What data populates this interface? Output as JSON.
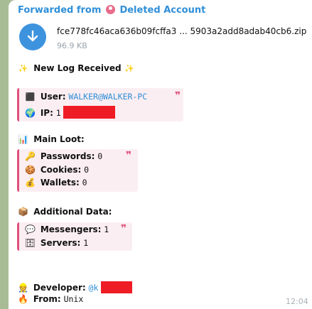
{
  "header": {
    "forwarded_prefix": "Forwarded from",
    "forwarded_from": "Deleted Account"
  },
  "file": {
    "name": "fce778fc46aca636b09fcffa3 ... 5903a2add8adab40cb6.zip",
    "size": "96.9 KB"
  },
  "log_title": "New Log Received",
  "user": {
    "label": "User:",
    "value": "WALKER@WALKER-PC",
    "ip_label": "IP:",
    "ip_value": "1"
  },
  "main_loot": {
    "heading": "Main Loot:",
    "passwords_label": "Passwords:",
    "passwords_value": "0",
    "cookies_label": "Cookies:",
    "cookies_value": "0",
    "wallets_label": "Wallets:",
    "wallets_value": "0"
  },
  "additional": {
    "heading": "Additional Data:",
    "messengers_label": "Messengers:",
    "messengers_value": "1",
    "servers_label": "Servers:",
    "servers_value": "1"
  },
  "developer": {
    "label": "Developer:",
    "value": "@k"
  },
  "from": {
    "label": "From:",
    "value": "Unix"
  },
  "timestamp": "12:04",
  "quote_mark": "❞",
  "icons": {
    "sparkle": "✨",
    "user": "⬛",
    "globe": "🌍",
    "chart": "📊",
    "key": "🔑",
    "cookie": "🍪",
    "wallet": "💰",
    "package": "📦",
    "speech": "💬",
    "server": "🗄",
    "developer": "👷",
    "fire": "🔥"
  },
  "colors": {
    "link": "#2f8fd8",
    "accent": "#e0507a",
    "quote_bg": "#fbeef2",
    "redaction": "#ee1c25",
    "file_icon": "#3d93de"
  }
}
